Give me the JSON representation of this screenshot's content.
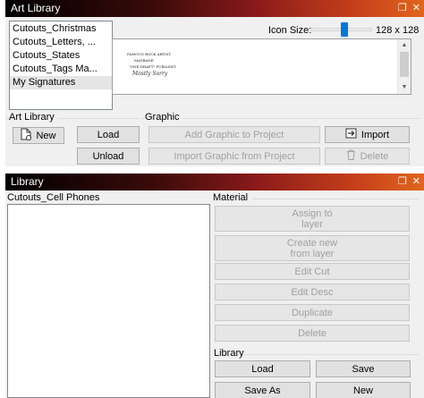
{
  "art_panel": {
    "title": "Art Library",
    "items": [
      "Cutouts_Christmas",
      "Cutouts_Letters, ...",
      "Cutouts_States",
      "Cutouts_Tags Ma...",
      "My Signatures"
    ],
    "selected_index": 4,
    "icon_size_label": "Icon Size:",
    "icon_size_value": "128 x 128",
    "icon_size_slider_fraction": 0.55,
    "preview_lines": [
      "FAMOUS ROCK ARTIST",
      "MAYBANE",
      "\"ONE DRAFT\" PUBLISHT",
      "Mostly Sorry"
    ],
    "art_library_group": "Art Library",
    "graphic_group": "Graphic",
    "buttons": {
      "new": "New",
      "load": "Load",
      "unload": "Unload",
      "add_graphic": "Add Graphic to Project",
      "import_graphic": "Import Graphic from Project",
      "import": "Import",
      "delete": "Delete"
    }
  },
  "library_panel": {
    "title": "Library",
    "list_label": "Cutouts_Cell Phones",
    "material_label": "Material",
    "material_buttons": {
      "assign": "Assign to\nlayer",
      "create": "Create new\nfrom layer",
      "edit_cut": "Edit Cut",
      "edit_desc": "Edit Desc",
      "duplicate": "Duplicate",
      "delete": "Delete"
    },
    "library_label": "Library",
    "library_buttons": {
      "load": "Load",
      "save": "Save",
      "save_as": "Save As",
      "new": "New"
    }
  },
  "colors": {
    "accent": "#0078d7",
    "title_gradient_end": "#e0661e"
  }
}
